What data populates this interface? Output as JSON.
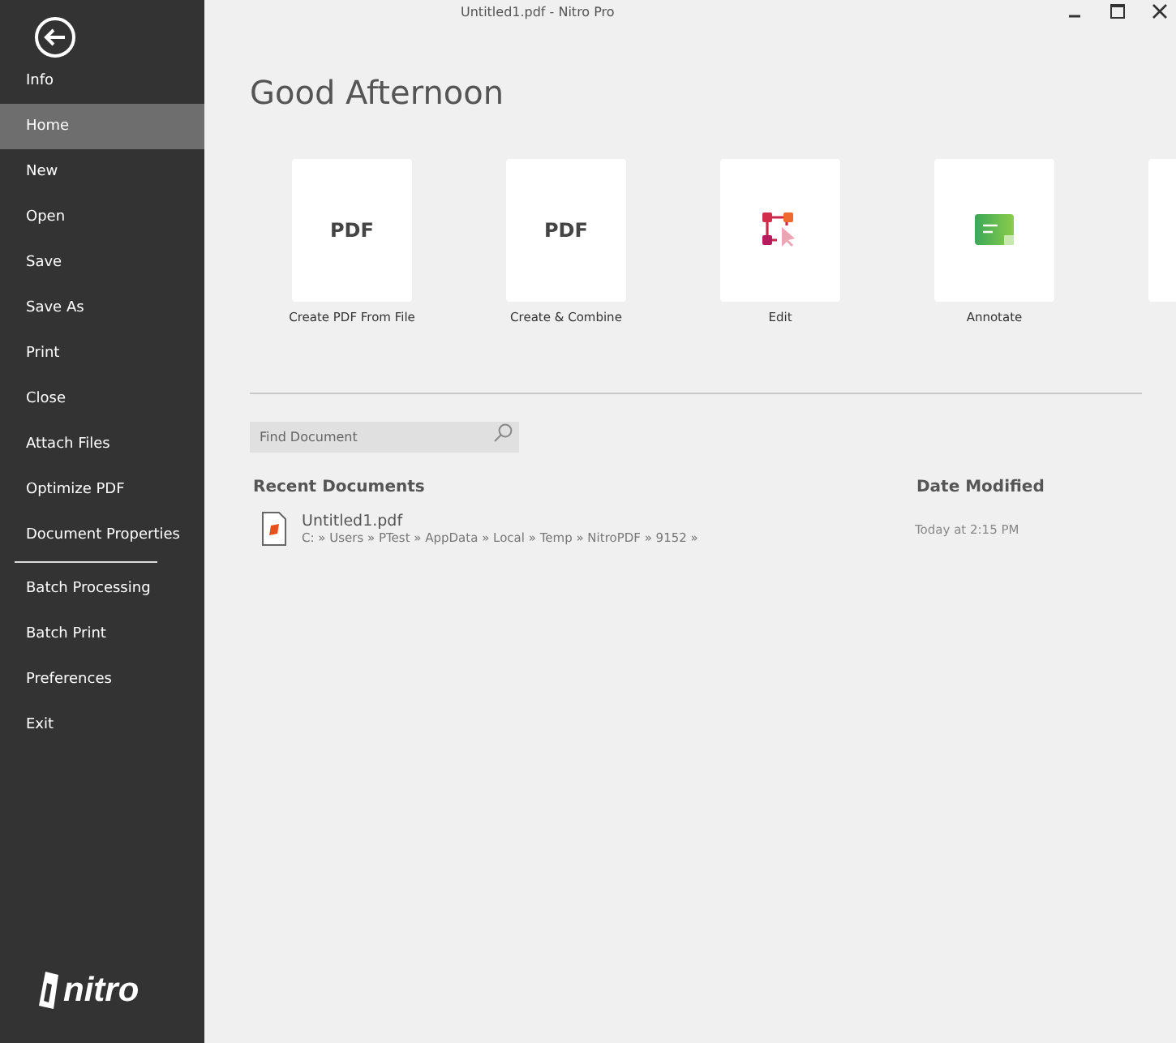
{
  "window": {
    "title": "Untitled1.pdf - Nitro Pro"
  },
  "sidebar": {
    "groups": [
      {
        "items": [
          {
            "label": "Info",
            "selected": false
          },
          {
            "label": "Home",
            "selected": true
          },
          {
            "label": "New",
            "selected": false
          },
          {
            "label": "Open",
            "selected": false
          },
          {
            "label": "Save",
            "selected": false
          },
          {
            "label": "Save As",
            "selected": false
          },
          {
            "label": "Print",
            "selected": false
          },
          {
            "label": "Close",
            "selected": false
          },
          {
            "label": "Attach Files",
            "selected": false
          },
          {
            "label": "Optimize PDF",
            "selected": false
          },
          {
            "label": "Document Properties",
            "selected": false
          }
        ]
      },
      {
        "items": [
          {
            "label": "Batch Processing",
            "selected": false
          },
          {
            "label": "Batch Print",
            "selected": false
          },
          {
            "label": "Preferences",
            "selected": false
          },
          {
            "label": "Exit",
            "selected": false
          }
        ]
      }
    ],
    "logo": "nitro"
  },
  "greeting": "Good Afternoon",
  "tiles": [
    {
      "kind": "pdf",
      "icon_text": "PDF",
      "label": "Create PDF From File"
    },
    {
      "kind": "pdf",
      "icon_text": "PDF",
      "label": "Create & Combine"
    },
    {
      "kind": "edit",
      "label": "Edit"
    },
    {
      "kind": "annotate",
      "label": "Annotate"
    },
    {
      "kind": "blank"
    }
  ],
  "search": {
    "placeholder": "Find Document"
  },
  "recent": {
    "heading": "Recent Documents",
    "date_heading": "Date Modified",
    "documents": [
      {
        "name": "Untitled1.pdf",
        "path": "C: » Users » PTest » AppData » Local » Temp » NitroPDF » 9152 »",
        "modified": "Today at 2:15 PM"
      }
    ]
  }
}
